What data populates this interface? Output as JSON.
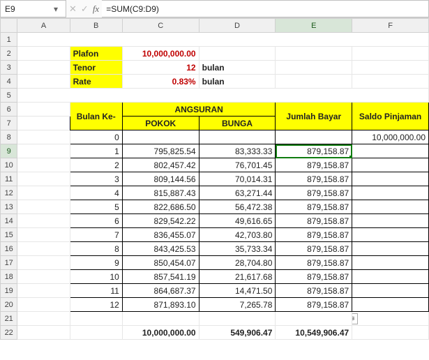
{
  "namebox": {
    "value": "E9",
    "dropdown_glyph": "▾"
  },
  "fxbar": {
    "cancel_glyph": "✕",
    "confirm_glyph": "✓",
    "fx_label": "fx",
    "formula": "=SUM(C9:D9)"
  },
  "col_headers": [
    "A",
    "B",
    "C",
    "D",
    "E",
    "F"
  ],
  "row_headers": [
    "1",
    "2",
    "3",
    "4",
    "5",
    "6",
    "7",
    "8",
    "9",
    "10",
    "11",
    "12",
    "13",
    "14",
    "15",
    "16",
    "17",
    "18",
    "19",
    "20",
    "21",
    "22"
  ],
  "top_params": {
    "plafon_label": "Plafon",
    "plafon_value": "10,000,000.00",
    "tenor_label": "Tenor",
    "tenor_value": "12",
    "tenor_unit": "bulan",
    "rate_label": "Rate",
    "rate_value": "0.83%",
    "rate_unit": "bulan"
  },
  "table_headers": {
    "bulan": "Bulan Ke-",
    "angsuran": "ANGSURAN",
    "pokok": "POKOK",
    "bunga": "BUNGA",
    "jumlah": "Jumlah Bayar",
    "saldo": "Saldo Pinjaman"
  },
  "rows": [
    {
      "n": "0",
      "pokok": "",
      "bunga": "",
      "jumlah": "",
      "saldo": "10,000,000.00"
    },
    {
      "n": "1",
      "pokok": "795,825.54",
      "bunga": "83,333.33",
      "jumlah": "879,158.87",
      "saldo": ""
    },
    {
      "n": "2",
      "pokok": "802,457.42",
      "bunga": "76,701.45",
      "jumlah": "879,158.87",
      "saldo": ""
    },
    {
      "n": "3",
      "pokok": "809,144.56",
      "bunga": "70,014.31",
      "jumlah": "879,158.87",
      "saldo": ""
    },
    {
      "n": "4",
      "pokok": "815,887.43",
      "bunga": "63,271.44",
      "jumlah": "879,158.87",
      "saldo": ""
    },
    {
      "n": "5",
      "pokok": "822,686.50",
      "bunga": "56,472.38",
      "jumlah": "879,158.87",
      "saldo": ""
    },
    {
      "n": "6",
      "pokok": "829,542.22",
      "bunga": "49,616.65",
      "jumlah": "879,158.87",
      "saldo": ""
    },
    {
      "n": "7",
      "pokok": "836,455.07",
      "bunga": "42,703.80",
      "jumlah": "879,158.87",
      "saldo": ""
    },
    {
      "n": "8",
      "pokok": "843,425.53",
      "bunga": "35,733.34",
      "jumlah": "879,158.87",
      "saldo": ""
    },
    {
      "n": "9",
      "pokok": "850,454.07",
      "bunga": "28,704.80",
      "jumlah": "879,158.87",
      "saldo": ""
    },
    {
      "n": "10",
      "pokok": "857,541.19",
      "bunga": "21,617.68",
      "jumlah": "879,158.87",
      "saldo": ""
    },
    {
      "n": "11",
      "pokok": "864,687.37",
      "bunga": "14,471.50",
      "jumlah": "879,158.87",
      "saldo": ""
    },
    {
      "n": "12",
      "pokok": "871,893.10",
      "bunga": "7,265.78",
      "jumlah": "879,158.87",
      "saldo": ""
    }
  ],
  "totals": {
    "pokok": "10,000,000.00",
    "bunga": "549,906.47",
    "jumlah": "10,549,906.47"
  },
  "active": {
    "col": "E",
    "row": "9"
  },
  "autofill_glyph": "⚞"
}
